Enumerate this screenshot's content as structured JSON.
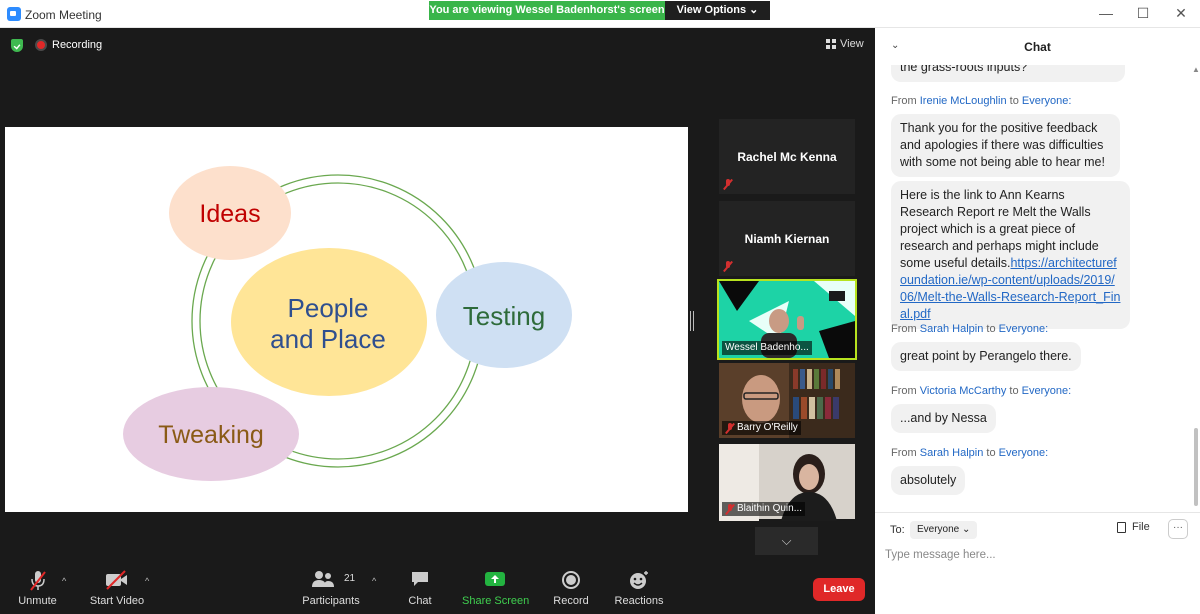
{
  "window": {
    "title": "Zoom Meeting",
    "share_banner": "You are viewing Wessel Badenhorst's screen",
    "view_options": "View Options",
    "minimize_glyph": "—",
    "maximize_glyph": "☐",
    "close_glyph": "✕"
  },
  "meeting": {
    "recording_label": "Recording",
    "view_label": "View"
  },
  "slide": {
    "bubbles": [
      {
        "text": "Ideas",
        "color": "#fde0cc",
        "text_color": "#c00000"
      },
      {
        "lines": [
          "People",
          "and Place"
        ],
        "color": "#ffe597",
        "text_color": "#2f4f8f"
      },
      {
        "text": "Testing",
        "color": "#cfe0f3",
        "text_color": "#2e6b3a"
      },
      {
        "text": "Tweaking",
        "color": "#e7cce1",
        "text_color": "#8a5a16"
      }
    ],
    "ring_color": "#6aa84f"
  },
  "participants": [
    {
      "name": "Rachel Mc Kenna",
      "muted": true
    },
    {
      "name": "Niamh Kiernan",
      "muted": true
    },
    {
      "name": "Wessel Badenho...",
      "muted": false,
      "active": true
    },
    {
      "name": "Barry O'Reilly",
      "muted": true
    },
    {
      "name": "Blaithin Quin...",
      "muted": true
    }
  ],
  "toolbar": {
    "unmute": "Unmute",
    "start_video": "Start Video",
    "participants": "Participants",
    "participants_count": "21",
    "chat": "Chat",
    "share_screen": "Share Screen",
    "record": "Record",
    "reactions": "Reactions",
    "leave": "Leave",
    "more_arrow": "⌵"
  },
  "chat": {
    "title": "Chat",
    "from_prefix": "From",
    "to_word": "to",
    "messages": [
      {
        "sender": "",
        "recipient": "",
        "text": "the grass-roots inputs?"
      },
      {
        "sender": "Irenie McLoughlin",
        "recipient": "Everyone:",
        "text": "Thank you for the positive feedback and apologies if there was difficulties with some not being able to hear me!"
      },
      {
        "sender": "",
        "recipient": "",
        "text": "Here is the link to Ann Kearns Research Report re Melt the Walls project which is a great piece of research and perhaps might include some useful details.",
        "link": "https://architecturefoundation.ie/wp-content/uploads/2019/06/Melt-the-Walls-Research-Report_Final.pdf"
      },
      {
        "sender": "Sarah Halpin",
        "recipient": "Everyone:",
        "text": "great point by Perangelo there."
      },
      {
        "sender": "Victoria McCarthy",
        "recipient": "Everyone:",
        "text": "...and by Nessa"
      },
      {
        "sender": "Sarah Halpin",
        "recipient": "Everyone:",
        "text": "absolutely"
      }
    ],
    "to_label": "To:",
    "to_value": "Everyone",
    "file_label": "File",
    "more_label": "···",
    "input_placeholder": "Type message here..."
  }
}
